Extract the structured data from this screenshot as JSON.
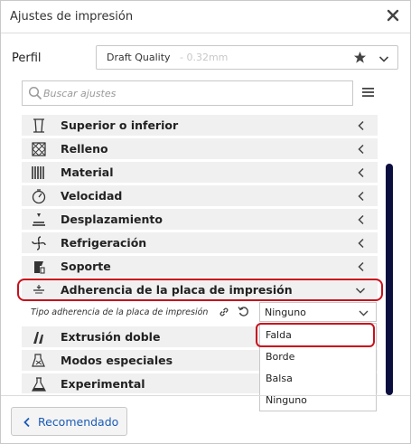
{
  "window": {
    "title": "Ajustes de impresión"
  },
  "profile": {
    "label": "Perfil",
    "name": "Draft Quality",
    "detail": "- 0.32mm"
  },
  "search": {
    "placeholder": "Buscar ajustes"
  },
  "categories": [
    {
      "label": "Superior o inferior",
      "icon": "top-bottom-icon"
    },
    {
      "label": "Relleno",
      "icon": "infill-icon"
    },
    {
      "label": "Material",
      "icon": "material-icon"
    },
    {
      "label": "Velocidad",
      "icon": "speed-icon"
    },
    {
      "label": "Desplazamiento",
      "icon": "travel-icon"
    },
    {
      "label": "Refrigeración",
      "icon": "cooling-fan-icon"
    },
    {
      "label": "Soporte",
      "icon": "support-icon"
    },
    {
      "label": "Adherencia de la placa de impresión",
      "icon": "build-plate-adhesion-icon",
      "expanded": true
    },
    {
      "label": "Extrusión doble",
      "icon": "dual-extrusion-icon"
    },
    {
      "label": "Modos especiales",
      "icon": "special-modes-icon"
    },
    {
      "label": "Experimental",
      "icon": "experimental-icon"
    }
  ],
  "adhesion_setting": {
    "label": "Tipo adherencia de la placa de impresión",
    "value": "Ninguno",
    "options": [
      "Falda",
      "Borde",
      "Balsa",
      "Ninguno"
    ],
    "highlighted_option": "Falda"
  },
  "footer": {
    "recommended_label": "Recomendado"
  },
  "colors": {
    "accent": "#1a5bb8",
    "highlight": "#c8101c",
    "scrollbar": "#0b0f3f",
    "row_bg": "#f0f0f0"
  }
}
